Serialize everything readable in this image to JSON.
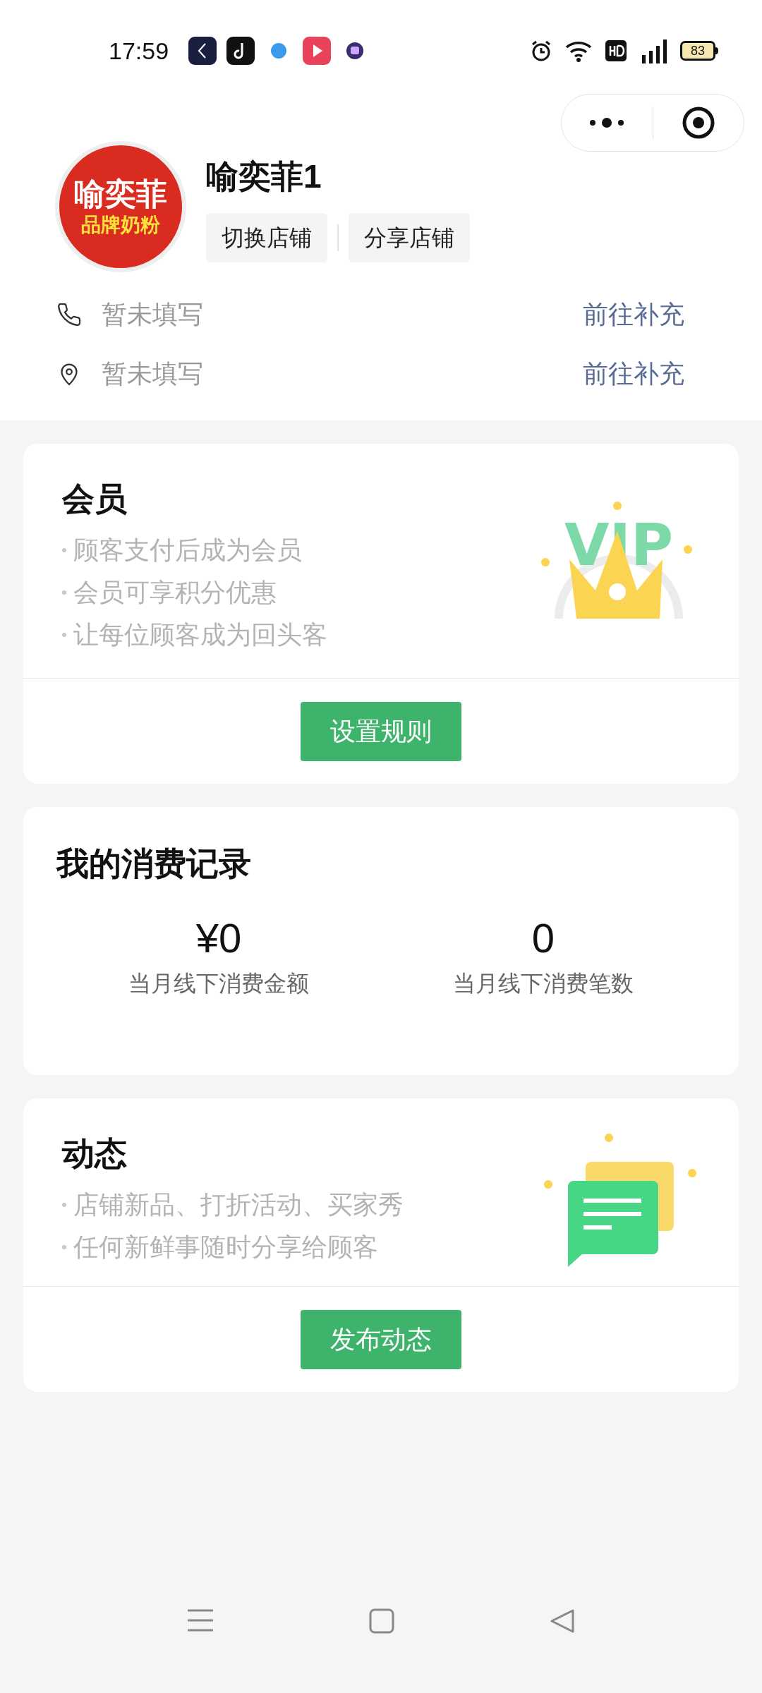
{
  "status_bar": {
    "time": "17:59",
    "battery": "83"
  },
  "shop": {
    "logo_lines": [
      "喻奕菲",
      "品牌奶粉"
    ],
    "name": "喻奕菲1",
    "actions": [
      "切换店铺",
      "分享店铺"
    ],
    "info_rows": [
      {
        "kind": "phone",
        "value": "暂未填写",
        "link": "前往补充"
      },
      {
        "kind": "address",
        "value": "暂未填写",
        "link": "前往补充"
      }
    ]
  },
  "member_card": {
    "title": "会员",
    "bullets": [
      "顾客支付后成为会员",
      "会员可享积分优惠",
      "让每位顾客成为回头客"
    ],
    "badge_text": "VIP",
    "button": "设置规则"
  },
  "spending_card": {
    "title": "我的消费记录",
    "stats": [
      {
        "value": "¥0",
        "label": "当月线下消费金额"
      },
      {
        "value": "0",
        "label": "当月线下消费笔数"
      }
    ]
  },
  "moments_card": {
    "title": "动态",
    "bullets": [
      "店铺新品、打折活动、买家秀",
      "任何新鲜事随时分享给顾客"
    ],
    "button": "发布动态"
  }
}
